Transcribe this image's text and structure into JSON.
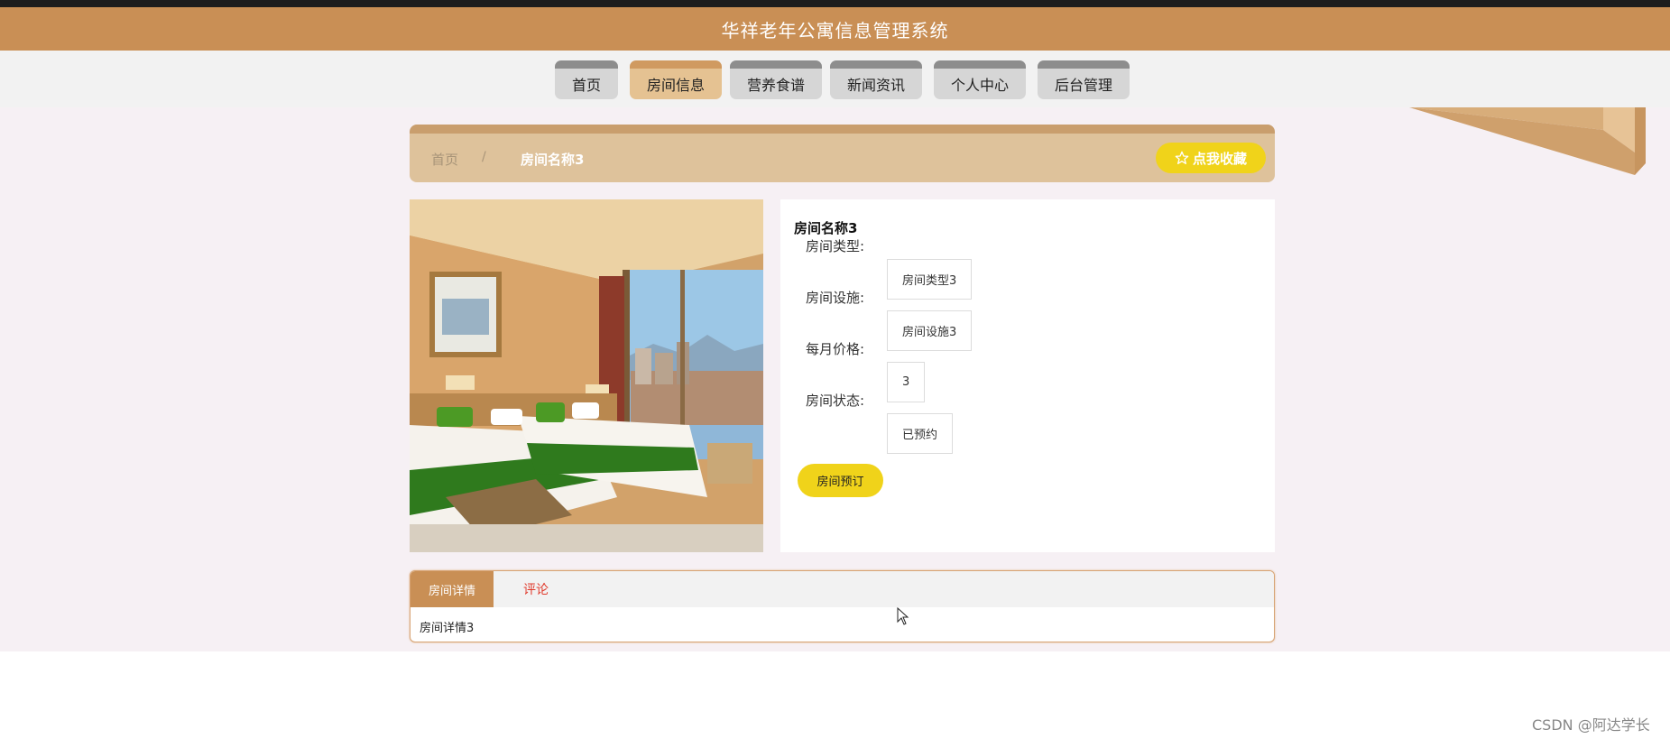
{
  "app": {
    "title": "华祥老年公寓信息管理系统"
  },
  "nav": {
    "items": [
      {
        "label": "首页"
      },
      {
        "label": "房间信息"
      },
      {
        "label": "营养食谱"
      },
      {
        "label": "新闻资讯"
      },
      {
        "label": "个人中心"
      },
      {
        "label": "后台管理"
      }
    ],
    "active": "房间信息"
  },
  "breadcrumb": {
    "home": "首页",
    "separator": "/",
    "current": "房间名称3"
  },
  "favorite_button": {
    "icon": "star-outline-icon",
    "label": "点我收藏"
  },
  "room": {
    "name": "房间名称3",
    "fields": [
      {
        "label": "房间类型:",
        "value": "房间类型3"
      },
      {
        "label": "房间设施:",
        "value": "房间设施3"
      },
      {
        "label": "每月价格:",
        "value": "3"
      },
      {
        "label": "房间状态:",
        "value": "已预约"
      }
    ],
    "book_button": "房间预订"
  },
  "tabs": {
    "items": [
      {
        "label": "房间详情"
      },
      {
        "label": "评论"
      }
    ],
    "content": "房间详情3"
  },
  "watermark": "CSDN @阿达学长",
  "colors": {
    "header": "#c98f55",
    "accent_yellow": "#f0d31a",
    "breadcrumb_bg": "#dec29b",
    "active_nav": "#e5c292",
    "comment_tab_text": "#e03a2c"
  }
}
